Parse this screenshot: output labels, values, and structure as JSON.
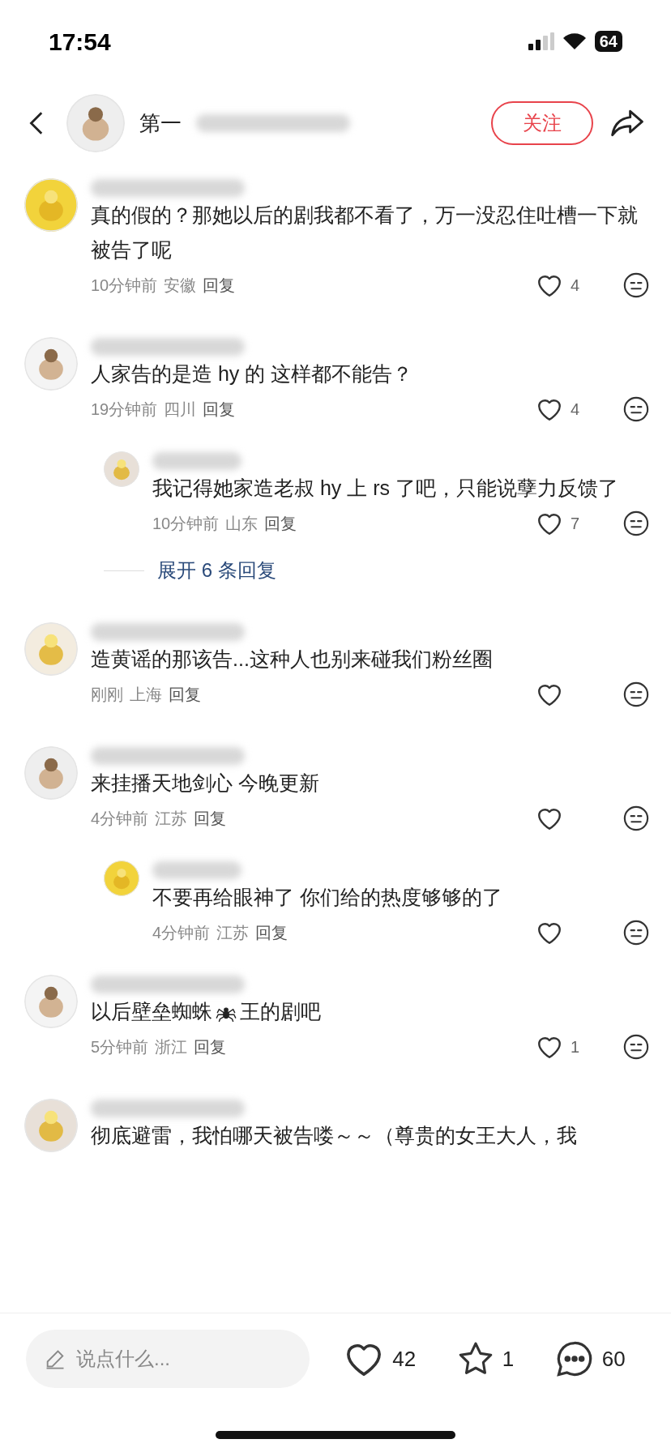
{
  "status_bar": {
    "time": "17:54",
    "battery": "64"
  },
  "header": {
    "title": "第一",
    "follow": "关注"
  },
  "comments": [
    {
      "kind": "comment",
      "segments": [
        {
          "kind": "text",
          "text": "真的假的？那她以后的剧我都不看了，万一没忍住吐槽一下就被告了呢"
        }
      ],
      "time": "10分钟前",
      "region": "安徽",
      "reply": "回复",
      "likes": "4"
    },
    {
      "kind": "comment",
      "segments": [
        {
          "kind": "text",
          "text": "人家告的是造 hy 的 这样都不能告？"
        }
      ],
      "time": "19分钟前",
      "region": "四川",
      "reply": "回复",
      "likes": "4"
    },
    {
      "kind": "reply",
      "segments": [
        {
          "kind": "text",
          "text": "我记得她家造老叔 hy 上 rs 了吧，只能说孽力反馈了"
        }
      ],
      "time": "10分钟前",
      "region": "山东",
      "reply": "回复",
      "likes": "7"
    },
    {
      "kind": "expand",
      "text": "展开 6 条回复"
    },
    {
      "kind": "comment",
      "segments": [
        {
          "kind": "text",
          "text": "造黄谣的那该告...这种人也别来碰我们粉丝圈"
        }
      ],
      "time": "刚刚",
      "region": "上海",
      "reply": "回复"
    },
    {
      "kind": "comment",
      "segments": [
        {
          "kind": "text",
          "text": "来挂播天地剑心 今晚更新"
        }
      ],
      "time": "4分钟前",
      "region": "江苏",
      "reply": "回复"
    },
    {
      "kind": "reply",
      "segments": [
        {
          "kind": "text",
          "text": "不要再给眼神了 你们给的热度够够的了"
        }
      ],
      "time": "4分钟前",
      "region": "江苏",
      "reply": "回复"
    },
    {
      "kind": "comment",
      "segments": [
        {
          "kind": "text",
          "text": "以后壁垒蜘蛛"
        },
        {
          "kind": "spider"
        },
        {
          "kind": "text",
          "text": "王的剧吧"
        }
      ],
      "time": "5分钟前",
      "region": "浙江",
      "reply": "回复",
      "likes": "1"
    },
    {
      "kind": "comment",
      "segments": [
        {
          "kind": "text",
          "text": "彻底避雷，我怕哪天被告喽～～（尊贵的女王大人，我"
        }
      ]
    }
  ],
  "bottom_bar": {
    "placeholder": "说点什么...",
    "likes": "42",
    "stars": "1",
    "comments": "60"
  }
}
